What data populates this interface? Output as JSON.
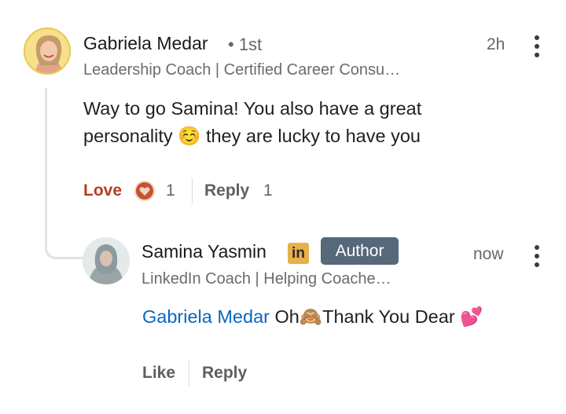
{
  "comment": {
    "author": "Gabriela Medar",
    "degree": "• 1st",
    "time": "2h",
    "headline": "Leadership Coach | Certified Career Consu…",
    "text_line1": "Way to go Samina! You also have a great",
    "text_line2": "personality ☺️ they are lucky to have you",
    "love_label": "Love",
    "love_count": "1",
    "reply_label": "Reply",
    "reply_count": "1"
  },
  "reply": {
    "author": "Samina Yasmin",
    "linkedin_badge": "in",
    "author_badge": "Author",
    "time": "now",
    "headline": "LinkedIn Coach | Helping Coache…",
    "mention": "Gabriela Medar",
    "text": " Oh🙈Thank You Dear 💕",
    "like_label": "Like",
    "reply_label": "Reply"
  },
  "colors": {
    "love_accent": "#b24020",
    "mention_link": "#0a66c2",
    "author_badge_bg": "#56687a",
    "linkedin_badge_bg": "#e8b04a"
  },
  "icons": {
    "love_reaction": "heart-icon",
    "overflow_menu": "more-vertical-icon"
  }
}
